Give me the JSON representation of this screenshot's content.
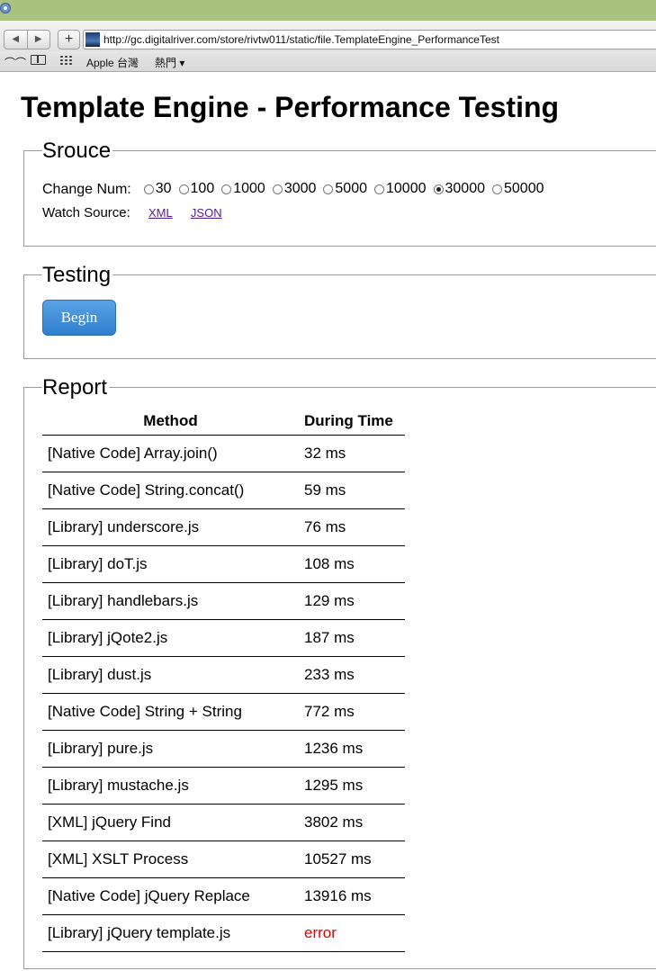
{
  "browser": {
    "url": "http://gc.digitalriver.com/store/rivtw011/static/file.TemplateEngine_PerformanceTest",
    "nav_back": "◀",
    "nav_forward": "▶",
    "add_tab": "+",
    "bookmarks": {
      "reading_glasses": "👓",
      "apple": "Apple 台灣",
      "hot": "熱門 ▾"
    }
  },
  "page": {
    "title": "Template Engine - Performance Testing",
    "source": {
      "legend": "Srouce",
      "change_num_label": "Change Num:",
      "options": [
        "30",
        "100",
        "1000",
        "3000",
        "5000",
        "10000",
        "30000",
        "50000"
      ],
      "selected": "30000",
      "watch_source_label": "Watch Source:",
      "links": [
        "XML",
        "JSON"
      ]
    },
    "testing": {
      "legend": "Testing",
      "begin_button": "Begin"
    },
    "report": {
      "legend": "Report",
      "headers": [
        "Method",
        "During Time"
      ],
      "rows": [
        {
          "method": "[Native Code] Array.join()",
          "time": "32 ms"
        },
        {
          "method": "[Native Code] String.concat()",
          "time": "59 ms"
        },
        {
          "method": "[Library] underscore.js",
          "time": "76 ms"
        },
        {
          "method": "[Library] doT.js",
          "time": "108 ms"
        },
        {
          "method": "[Library] handlebars.js",
          "time": "129 ms"
        },
        {
          "method": "[Library] jQote2.js",
          "time": "187 ms"
        },
        {
          "method": "[Library] dust.js",
          "time": "233 ms"
        },
        {
          "method": "[Native Code] String + String",
          "time": "772 ms"
        },
        {
          "method": "[Library] pure.js",
          "time": "1236 ms"
        },
        {
          "method": "[Library] mustache.js",
          "time": "1295 ms"
        },
        {
          "method": "[XML] jQuery Find",
          "time": "3802 ms"
        },
        {
          "method": "[XML] XSLT Process",
          "time": "10527 ms"
        },
        {
          "method": "[Native Code] jQuery Replace",
          "time": "13916 ms"
        },
        {
          "method": "[Library] jQuery template.js",
          "time": "error"
        }
      ]
    }
  },
  "colors": {
    "error": "#e00000",
    "button": "#3a8ad8",
    "link": "#551a8b"
  }
}
